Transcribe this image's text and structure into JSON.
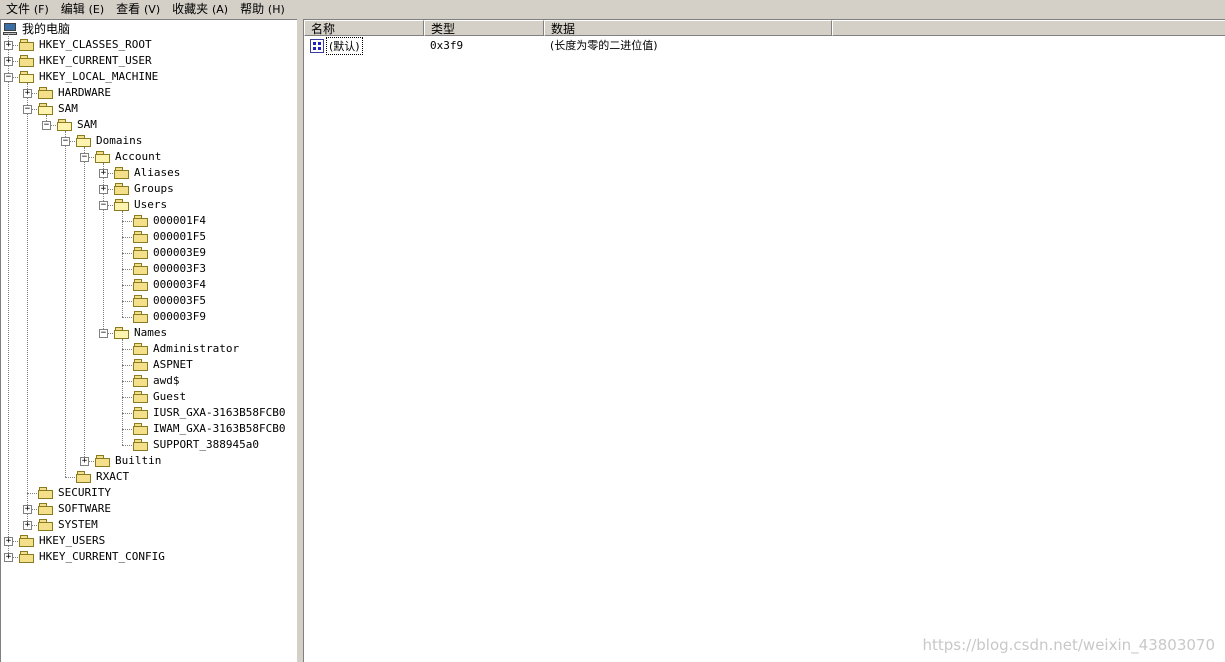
{
  "menu": [
    {
      "label": "文件",
      "accel": "(F)"
    },
    {
      "label": "编辑",
      "accel": "(E)"
    },
    {
      "label": "查看",
      "accel": "(V)"
    },
    {
      "label": "收藏夹",
      "accel": "(A)"
    },
    {
      "label": "帮助",
      "accel": "(H)"
    }
  ],
  "tree": {
    "root": "我的电脑",
    "nodes": [
      "HKEY_CLASSES_ROOT",
      "HKEY_CURRENT_USER",
      "HKEY_LOCAL_MACHINE",
      "HARDWARE",
      "SAM",
      "SAM",
      "Domains",
      "Account",
      "Aliases",
      "Groups",
      "Users",
      "000001F4",
      "000001F5",
      "000003E9",
      "000003F3",
      "000003F4",
      "000003F5",
      "000003F9",
      "Names",
      "Administrator",
      "ASPNET",
      "awd$",
      "Guest",
      "IUSR_GXA-3163B58FCB0",
      "IWAM_GXA-3163B58FCB0",
      "SUPPORT_388945a0",
      "Builtin",
      "RXACT",
      "SECURITY",
      "SOFTWARE",
      "SYSTEM",
      "HKEY_USERS",
      "HKEY_CURRENT_CONFIG"
    ]
  },
  "list": {
    "columns": [
      "名称",
      "类型",
      "数据"
    ],
    "rows": [
      {
        "name": "(默认)",
        "type": "0x3f9",
        "data": "(长度为零的二进位值)"
      }
    ]
  },
  "watermark": "https://blog.csdn.net/weixin_43803070"
}
